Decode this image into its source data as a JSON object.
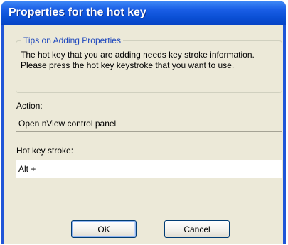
{
  "dialog": {
    "title": "Properties for the hot key"
  },
  "tips": {
    "legend": "Tips on Adding Properties",
    "text": "The hot key that you are adding needs key stroke information. Please press the hot key keystroke that you want to use."
  },
  "action": {
    "label": "Action:",
    "value": "Open nView control panel"
  },
  "hotkey": {
    "label": "Hot key stroke:",
    "value": "Alt +"
  },
  "buttons": {
    "ok_label": "OK",
    "cancel_label": "Cancel"
  },
  "colors": {
    "titlebar": "#0a4fd4",
    "dialog_face": "#ece9d8",
    "groupbox_legend": "#1c46bd"
  }
}
